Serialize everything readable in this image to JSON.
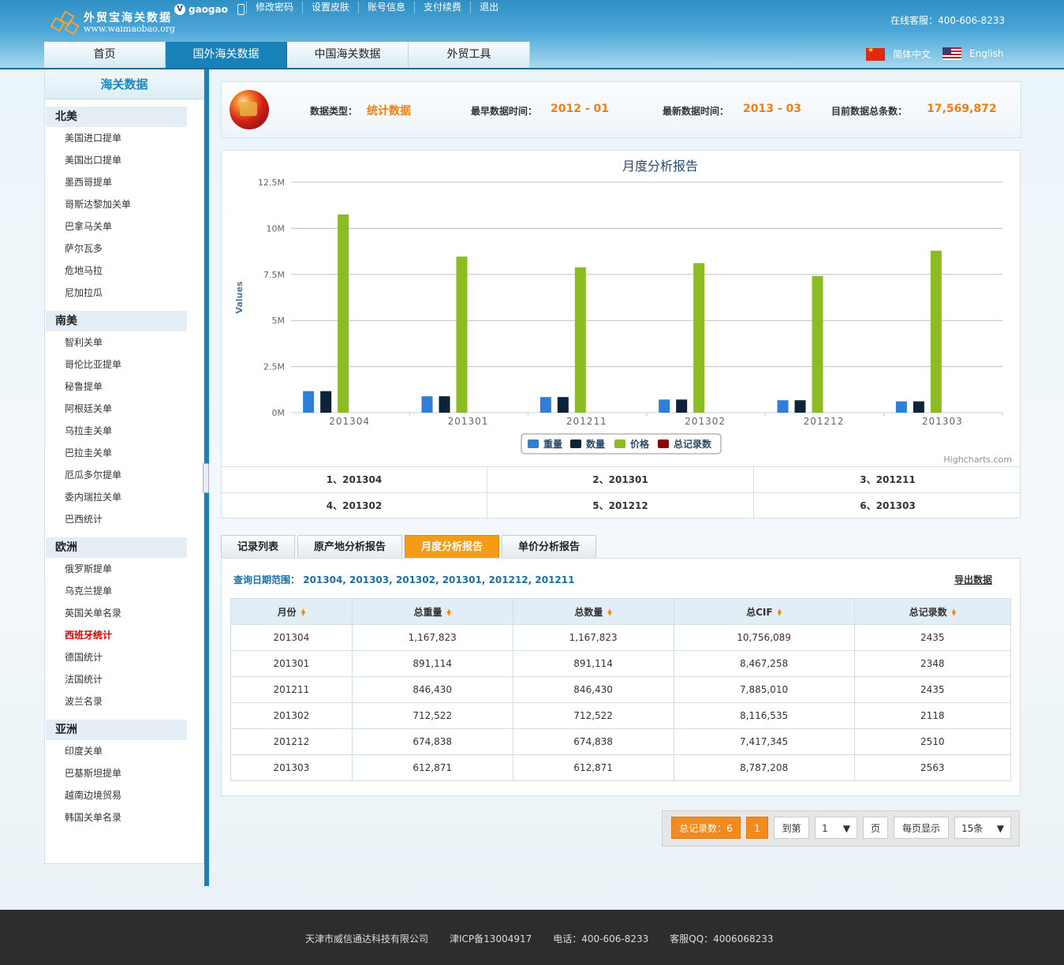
{
  "header": {
    "logo_title": "外贸宝海关数据",
    "logo_url": "www.waimaobao.org",
    "username": "gaogao",
    "top_links": [
      "修改密码",
      "设置皮肤",
      "账号信息",
      "支付续费",
      "退出"
    ],
    "service": "在线客服：400-606-8233",
    "nav": [
      "首页",
      "国外海关数据",
      "中国海关数据",
      "外贸工具"
    ],
    "nav_active": "国外海关数据",
    "lang_cn": "简体中文",
    "lang_en": "English"
  },
  "sidebar": {
    "title": "海关数据",
    "groups": [
      {
        "title": "北美",
        "items": [
          "美国进口提单",
          "美国出口提单",
          "墨西哥提单",
          "哥斯达黎加关单",
          "巴拿马关单",
          "萨尔瓦多",
          "危地马拉",
          "尼加拉瓜"
        ]
      },
      {
        "title": "南美",
        "items": [
          "智利关单",
          "哥伦比亚提单",
          "秘鲁提单",
          "阿根廷关单",
          "乌拉圭关单",
          "巴拉圭关单",
          "厄瓜多尔提单",
          "委内瑞拉关单",
          "巴西统计"
        ]
      },
      {
        "title": "欧洲",
        "items": [
          "俄罗斯提单",
          "乌克兰提单",
          "英国关单名录",
          "西班牙统计",
          "德国统计",
          "法国统计",
          "波兰名录"
        ]
      },
      {
        "title": "亚洲",
        "items": [
          "印度关单",
          "巴基斯坦提单",
          "越南边境贸易",
          "韩国关单名录"
        ]
      }
    ],
    "active_item": "西班牙统计"
  },
  "info": {
    "type_label": "数据类型：",
    "type_value": "统计数据",
    "earliest_label": "最早数据时间：",
    "earliest_value": "2012 - 01",
    "latest_label": "最新数据时间：",
    "latest_value": "2013 - 03",
    "total_label": "目前数据总条数：",
    "total_value": "17,569,872"
  },
  "chart_data": {
    "type": "bar",
    "title": "月度分析报告",
    "ylabel": "Values",
    "ylim": [
      0,
      12500000
    ],
    "yticks": [
      "0M",
      "2.5M",
      "5M",
      "7.5M",
      "10M",
      "12.5M"
    ],
    "categories": [
      "201304",
      "201301",
      "201211",
      "201302",
      "201212",
      "201303"
    ],
    "series": [
      {
        "name": "重量",
        "color": "#2f7ed8",
        "values": [
          1167823,
          891114,
          846430,
          712522,
          674838,
          612871
        ]
      },
      {
        "name": "数量",
        "color": "#0d233a",
        "values": [
          1167823,
          891114,
          846430,
          712522,
          674838,
          612871
        ]
      },
      {
        "name": "价格",
        "color": "#8bbc21",
        "values": [
          10756089,
          8467258,
          7885010,
          8116535,
          7417345,
          8787208
        ]
      },
      {
        "name": "总记录数",
        "color": "#910000",
        "values": [
          2435,
          2348,
          2435,
          2118,
          2510,
          2563
        ]
      }
    ],
    "credit": "Highcharts.com",
    "legend": "bottom-center",
    "grid": true
  },
  "stat_cells": [
    "1、201304",
    "2、201301",
    "3、201211",
    "4、201302",
    "5、201212",
    "6、201303"
  ],
  "tabs": [
    "记录列表",
    "原产地分析报告",
    "月度分析报告",
    "单价分析报告"
  ],
  "active_tab": "月度分析报告",
  "query": {
    "label": "查询日期范围：",
    "value": "201304, 201303, 201302, 201301, 201212, 201211",
    "export": "导出数据"
  },
  "table": {
    "headers": [
      "月份",
      "总重量",
      "总数量",
      "总CIF",
      "总记录数"
    ],
    "rows": [
      [
        "201304",
        "1,167,823",
        "1,167,823",
        "10,756,089",
        "2435"
      ],
      [
        "201301",
        "891,114",
        "891,114",
        "8,467,258",
        "2348"
      ],
      [
        "201211",
        "846,430",
        "846,430",
        "7,885,010",
        "2435"
      ],
      [
        "201302",
        "712,522",
        "712,522",
        "8,116,535",
        "2118"
      ],
      [
        "201212",
        "674,838",
        "674,838",
        "7,417,345",
        "2510"
      ],
      [
        "201303",
        "612,871",
        "612,871",
        "8,787,208",
        "2563"
      ]
    ]
  },
  "pager": {
    "total": "总记录数：6",
    "current_page": "1",
    "goto": "到第",
    "page_select": "1",
    "page_unit": "页",
    "per_page_label": "每页显示",
    "per_page_select": "15条"
  },
  "footer": {
    "company": "天津市威信通达科技有限公司",
    "icp": "津ICP备13004917",
    "phone": "电话：400-606-8233",
    "qq": "客服QQ：4006068233"
  }
}
